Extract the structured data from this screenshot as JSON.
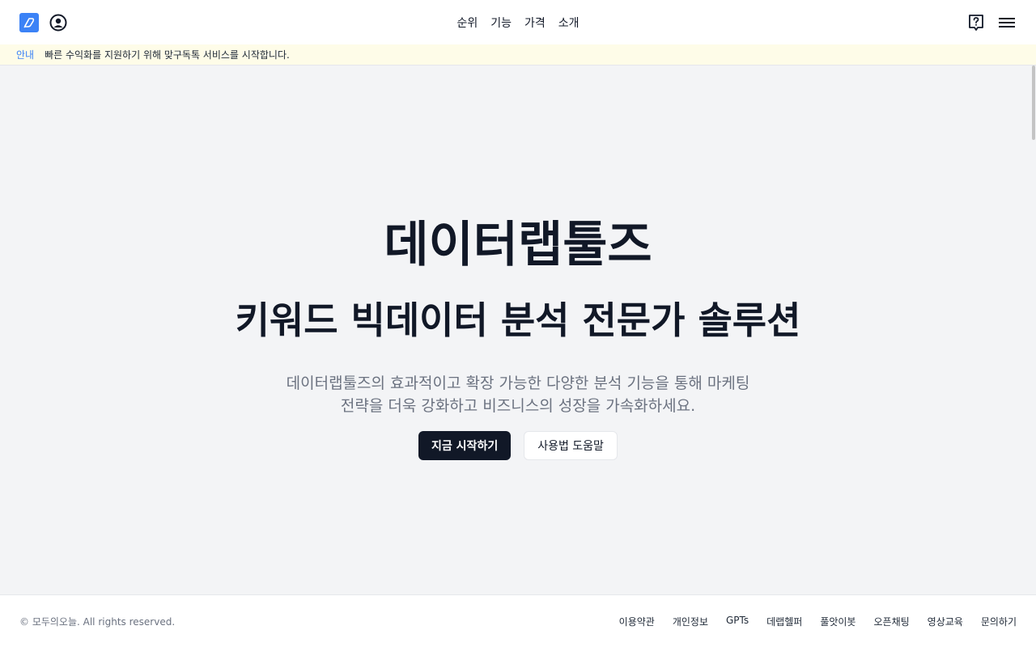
{
  "header": {
    "nav": [
      "순위",
      "기능",
      "가격",
      "소개"
    ],
    "icons": {
      "logo": "datalab-logo-icon",
      "user": "user-circle-icon",
      "help": "help-question-icon",
      "menu": "hamburger-menu-icon"
    }
  },
  "notice": {
    "tag": "안내",
    "text": "빠른 수익화를 지원하기 위해 맞구독톡 서비스를 시작합니다."
  },
  "hero": {
    "title": "데이터랩툴즈",
    "subtitle": "키워드 빅데이터 분석 전문가 솔루션",
    "desc_line1": "데이터랩툴즈의 효과적이고 확장 가능한 다양한 분석 기능을 통해 마케팅",
    "desc_line2": "전략을 더욱 강화하고 비즈니스의 성장을 가속화하세요.",
    "primary_button": "지금 시작하기",
    "secondary_button": "사용법 도움말"
  },
  "footer": {
    "copyright": "© 모두의오늘. All rights reserved.",
    "links": [
      "이용약관",
      "개인정보",
      "GPTs",
      "데랩헬퍼",
      "풀앗이봇",
      "오픈채팅",
      "영상교육",
      "문의하기"
    ]
  },
  "colors": {
    "accent": "#3b82f6",
    "primary_button_bg": "#111827",
    "notice_bg": "#fefce8",
    "page_bg": "#f3f4f6"
  }
}
